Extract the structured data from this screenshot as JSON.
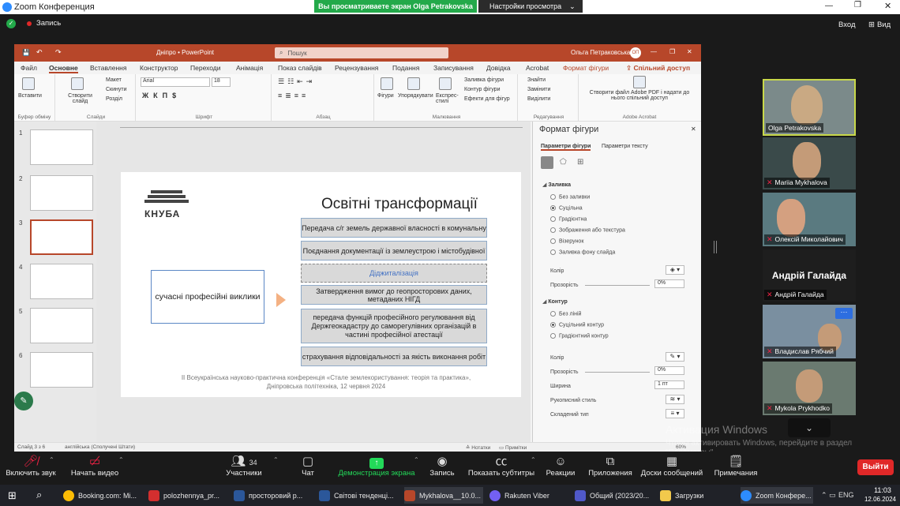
{
  "zoom": {
    "title": "Zoom Конференция",
    "viewing": "Вы просматриваете экран Olga Petrakovska",
    "view_settings": "Настройки просмотра",
    "record": "Запись",
    "exit_btn": "Вход",
    "view_btn": "Вид"
  },
  "ppt": {
    "file": "Дніпро",
    "app": "PowerPoint",
    "search": "Пошук",
    "user": "Ольга Петраковська",
    "user_initials": "ОП",
    "tabs": [
      "Файл",
      "Основне",
      "Вставлення",
      "Конструктор",
      "Переходи",
      "Анімація",
      "Показ слайдів",
      "Рецензування",
      "Подання",
      "Записування",
      "Довідка",
      "Acrobat",
      "Формат фігури"
    ],
    "share": "Спільний доступ",
    "ribbon": {
      "paste": "Вставити",
      "clipboard": "Буфер обміну",
      "new_slide": "Створити слайд",
      "layout": "Макет",
      "reset": "Скинути",
      "section": "Розділ",
      "slides": "Слайди",
      "font": "Arial",
      "size": "18",
      "font_group": "Шрифт",
      "para_group": "Абзац",
      "shapes": "Фігури",
      "arrange": "Упорядкувати",
      "quick": "Експрес-стилі",
      "fill": "Заливка фігури",
      "outline": "Контур фігури",
      "effects": "Ефекти для фігур",
      "drawing": "Малювання",
      "find": "Знайти",
      "replace": "Замінити",
      "select": "Виділити",
      "editing": "Редагування",
      "pdf": "Створити файл Adobe PDF і надати до нього спільний доступ",
      "acrobat": "Adobe Acrobat"
    },
    "status_left": "Слайд 3 з 6",
    "status_lang": "англійська (Сполучені Штати)",
    "notes": "Нотатки",
    "comments": "Примітки",
    "zoom_pct": "60%"
  },
  "slide": {
    "logo": "КНУБА",
    "title": "Освітні трансформації",
    "left_box": "сучасні професійні виклики",
    "items": [
      "Передача с/г земель державної власності в комунальну",
      "Поєднання документації із землеустрою і містобудівної",
      "Діджиталізація",
      "Затвердження вимог до геопросторових даних, метаданих НІГД",
      "передача функцій професійного регулювання від Держгеокадастру до саморегулівних організацій в частині професійної атестації",
      "страхування відповідальності за якість виконання робіт"
    ],
    "footer1": "ІІ Всеукраїнська науково-практична конференція «Стале землекористування: теорія та практика»,",
    "footer2": "Дніпровська політехніка, 12 червня 2024"
  },
  "thumbs": [
    "1",
    "2",
    "3",
    "4",
    "5",
    "6"
  ],
  "format": {
    "title": "Формат фігури",
    "tab1": "Параметри фігури",
    "tab2": "Параметри тексту",
    "fill": "Заливка",
    "fill_opts": [
      "Без заливки",
      "Суцільна",
      "Градієнтна",
      "Зображення або текстура",
      "Візерунок",
      "Заливка фону слайда"
    ],
    "color": "Колір",
    "transp": "Прозорість",
    "transp_val": "0%",
    "outline": "Контур",
    "line_opts": [
      "Без ліній",
      "Суцільний контур",
      "Градієнтний контур"
    ],
    "color2": "Колір",
    "transp2": "Прозорість",
    "transp_val2": "0%",
    "width": "Ширина",
    "width_val": "1 пт",
    "sketch": "Рукописний стиль",
    "compound": "Складений тип"
  },
  "participants": [
    "Olga Petrakovska",
    "Mariia Mykhalova",
    "Олексій Миколайович",
    "Андрій Галайда",
    "Андрій Галайда",
    "Владислав Рябчий",
    "Mykola Prykhodko"
  ],
  "activation": {
    "title": "Активация Windows",
    "text": "Чтобы активировать Windows, перейдите в раздел \"Параметры\"."
  },
  "toolbar": {
    "mute": "Включить звук",
    "video": "Начать видео",
    "participants": "Участники",
    "participants_count": "34",
    "chat": "Чат",
    "share": "Демонстрация экрана",
    "record": "Запись",
    "subtitles": "Показать субтитры",
    "reactions": "Реакции",
    "apps": "Приложения",
    "whiteboard": "Доски сообщений",
    "notes": "Примечания",
    "leave": "Выйти"
  },
  "taskbar": {
    "items": [
      "Booking.com: Mi...",
      "polozhennya_pr...",
      "просторовий р...",
      "Світові тенденці...",
      "Mykhalova__10.0...",
      "Rakuten Viber",
      "Общий (2023/20...",
      "Загрузки",
      "Zoom Конфере..."
    ],
    "lang": "ENG",
    "time": "11:03",
    "date": "12.06.2024"
  },
  "colors": {
    "ppt": "#b7472a",
    "share_green": "#23d959",
    "leave": "#e02828"
  }
}
